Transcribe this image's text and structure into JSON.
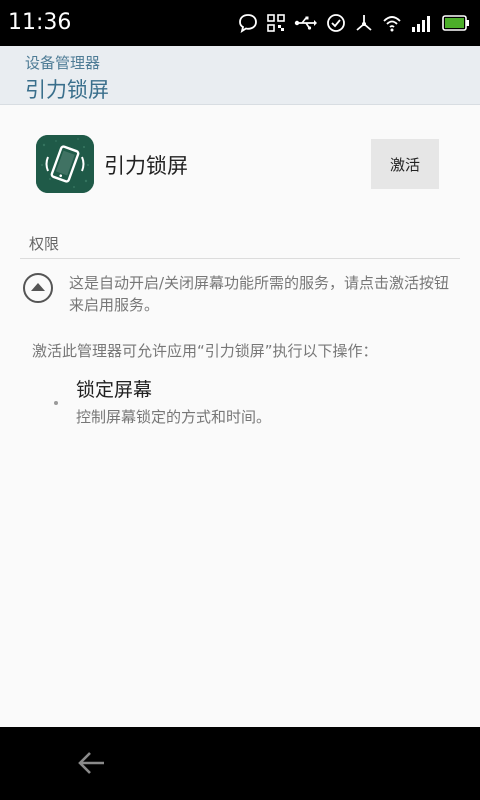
{
  "status_bar": {
    "time": "11:36",
    "icons": [
      "chat-icon",
      "qr-icon",
      "usb-icon",
      "check-circle-icon",
      "debug-icon",
      "wifi-icon",
      "signal-icon",
      "battery-icon"
    ]
  },
  "header": {
    "subtitle": "设备管理器",
    "title": "引力锁屏"
  },
  "app": {
    "name": "引力锁屏",
    "activate_label": "激活",
    "icon_color": "#1f5a48"
  },
  "permissions": {
    "section_title": "权限",
    "description": "这是自动开启/关闭屏幕功能所需的服务，请点击激活按钮来启用服务。",
    "intro": "激活此管理器可允许应用“引力锁屏”执行以下操作：",
    "policies": [
      {
        "title": "锁定屏幕",
        "description": "控制屏幕锁定的方式和时间。"
      }
    ]
  },
  "colors": {
    "accent": "#3a6f8c",
    "header_bg": "#e9edf1",
    "button_bg": "#e6e6e6"
  }
}
